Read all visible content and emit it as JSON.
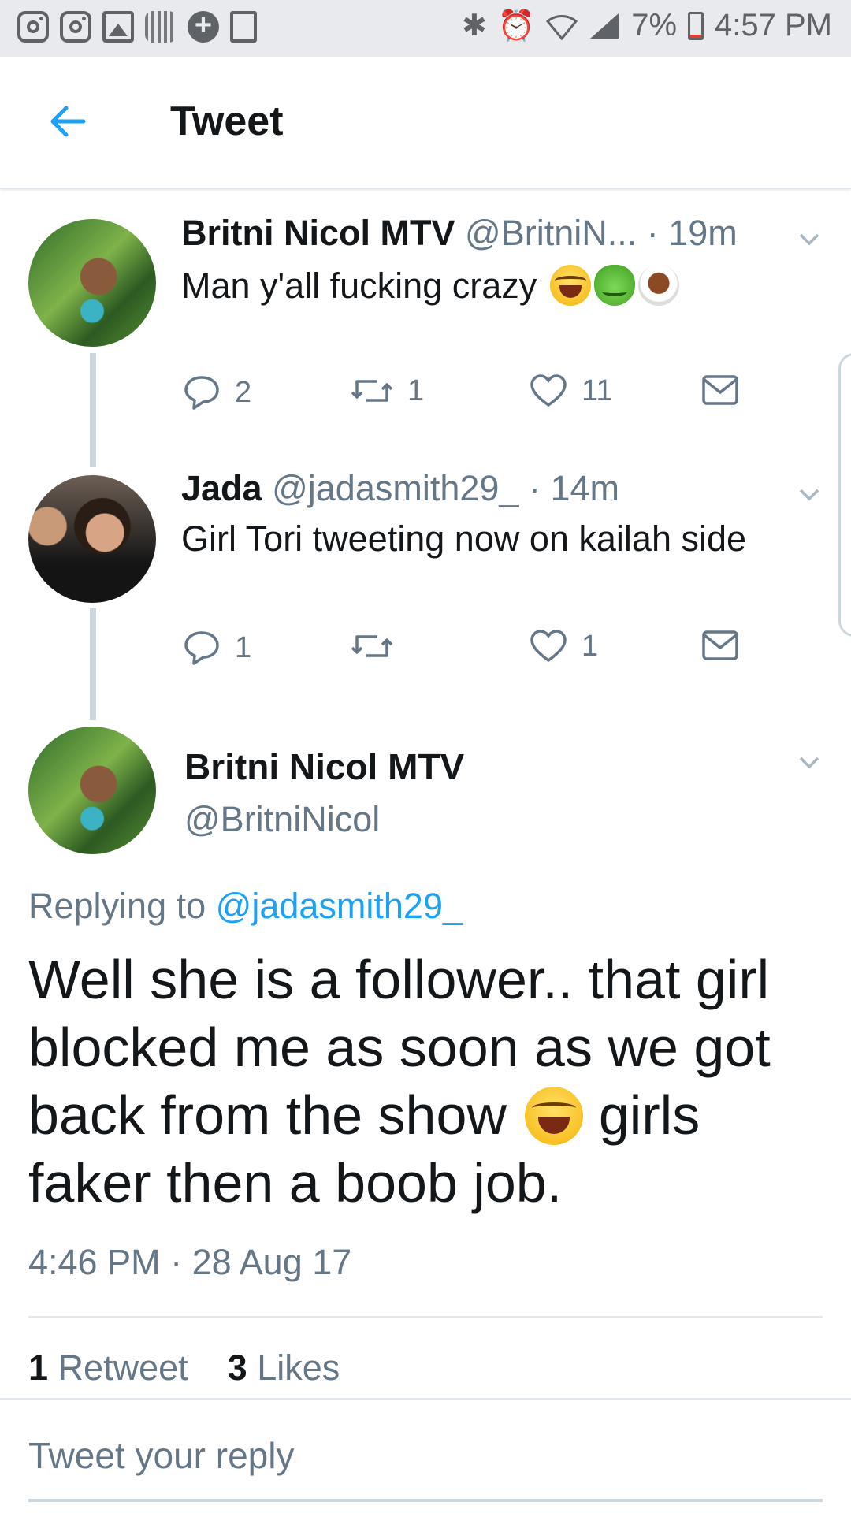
{
  "status_bar": {
    "battery": "7%",
    "time": "4:57 PM",
    "left_icons": [
      "instagram-icon",
      "instagram-icon",
      "gallery-icon",
      "qr-icon",
      "health-icon",
      "document-icon"
    ],
    "right_icons": [
      "bluetooth-icon",
      "alarm-icon",
      "wifi-icon",
      "signal-icon",
      "battery-icon"
    ]
  },
  "header": {
    "title": "Tweet",
    "back_icon": "back-arrow-icon"
  },
  "thread": [
    {
      "name": "Britni Nicol MTV",
      "handle": "@BritniN...",
      "time": "· 19m",
      "text": "Man y'all fucking crazy",
      "emojis": [
        "tears-of-joy",
        "frog",
        "latte"
      ],
      "replies": "2",
      "retweets": "1",
      "likes": "11"
    },
    {
      "name": "Jada",
      "handle": "@jadasmith29_",
      "time": "· 14m",
      "text": "Girl Tori tweeting now on kailah side",
      "replies": "1",
      "retweets": "",
      "likes": "1"
    }
  ],
  "main_tweet": {
    "name": "Britni Nicol MTV",
    "handle": "@BritniNicol",
    "replying_prefix": "Replying to",
    "replying_to": "@jadasmith29_",
    "text_part1": "Well she is a follower.. that girl blocked me as soon as we got back from the show",
    "emoji": "tears-of-joy",
    "text_part2": "girls faker then a boob job.",
    "timestamp": "4:46 PM · 28 Aug 17",
    "retweet_count": "1",
    "retweet_label": "Retweet",
    "like_count": "3",
    "like_label": "Likes"
  },
  "compose": {
    "placeholder": "Tweet your reply"
  },
  "colors": {
    "accent": "#1da1f2",
    "secondary_text": "#657786",
    "thread_line": "#ccd6dd"
  }
}
